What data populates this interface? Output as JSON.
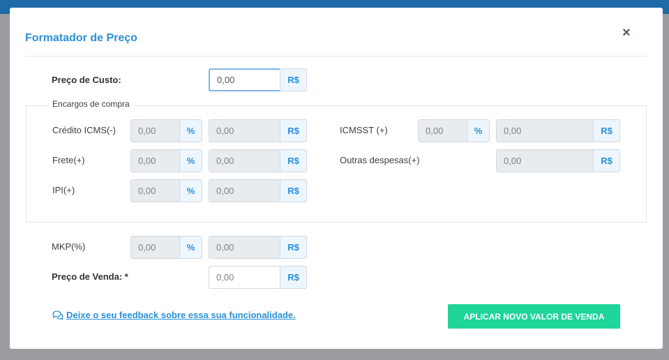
{
  "modal": {
    "title": "Formatador de Preço",
    "close_glyph": "×"
  },
  "custo": {
    "label": "Preço de Custo:",
    "value": "0,00",
    "currency": "R$"
  },
  "encargos": {
    "legend": "Encargos de compra",
    "credito_icms": {
      "label": "Crédito ICMS(-)",
      "pct_value": "0,00",
      "pct_glyph": "%",
      "rs_value": "0,00",
      "currency": "R$"
    },
    "frete": {
      "label": "Frete(+)",
      "pct_value": "0,00",
      "pct_glyph": "%",
      "rs_value": "0,00",
      "currency": "R$"
    },
    "ipi": {
      "label": "IPI(+)",
      "pct_value": "0,00",
      "pct_glyph": "%",
      "rs_value": "0,00",
      "currency": "R$"
    },
    "icmsst": {
      "label": "ICMSST (+)",
      "pct_value": "0,00",
      "pct_glyph": "%",
      "rs_value": "0,00",
      "currency": "R$"
    },
    "outras": {
      "label": "Outras despesas(+)",
      "rs_value": "0,00",
      "currency": "R$"
    }
  },
  "mkp": {
    "label": "MKP(%)",
    "pct_value": "0,00",
    "pct_glyph": "%",
    "rs_value": "0,00",
    "currency": "R$"
  },
  "venda": {
    "label": "Preço de Venda: *",
    "value": "0,00",
    "currency": "R$"
  },
  "footer": {
    "feedback_text": "Deixe o seu feedback sobre essa sua funcionalidade.",
    "feedback_icon": "comments-icon",
    "apply_label": "APLICAR NOVO VALOR DE VENDA"
  },
  "colors": {
    "accent": "#2a90d6",
    "apply": "#1fd59a",
    "topbar": "#1f6aa8"
  }
}
